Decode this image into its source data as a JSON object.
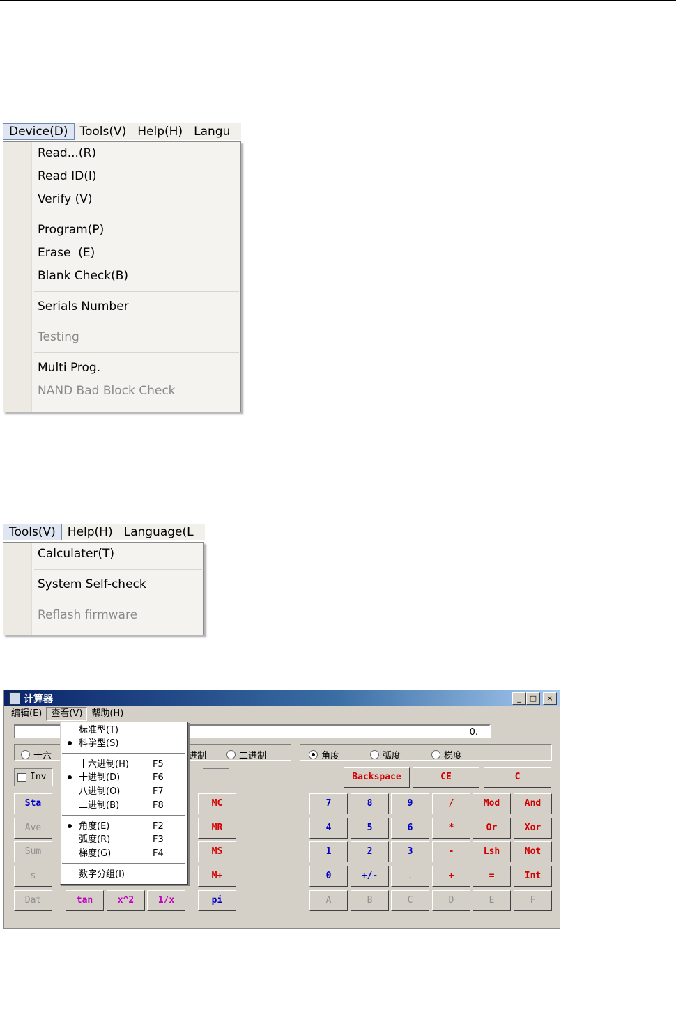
{
  "menubar1": {
    "items": [
      "Device(D)",
      "Tools(V)",
      "Help(H)",
      "Langu"
    ]
  },
  "device_menu": {
    "items": [
      {
        "label": "Read...(R)"
      },
      {
        "label": "Read ID(I)"
      },
      {
        "label": "Verify (V)"
      },
      {
        "label": "Program(P)"
      },
      {
        "label": "Erase  (E)"
      },
      {
        "label": "Blank Check(B)"
      },
      {
        "label": "Serials Number"
      },
      {
        "label": "Testing",
        "disabled": true
      },
      {
        "label": "Multi Prog."
      },
      {
        "label": "NAND Bad Block Check",
        "disabled": true
      }
    ]
  },
  "menubar2": {
    "items": [
      "Tools(V)",
      "Help(H)",
      "Language(L"
    ]
  },
  "tools_menu": {
    "items": [
      {
        "label": "Calculater(T)"
      },
      {
        "label": "System Self-check"
      },
      {
        "label": "Reflash firmware",
        "disabled": true
      }
    ]
  },
  "calculator": {
    "title": "计算器",
    "window_buttons": [
      "_",
      "□",
      "×"
    ],
    "menu": [
      "编辑(E)",
      "查看(V)",
      "帮助(H)"
    ],
    "display": "0.",
    "base_radios": [
      "十六",
      "进制",
      "二进制"
    ],
    "angle_radios": [
      "角度",
      "弧度",
      "梯度"
    ],
    "inv_label": "Inv",
    "view_menu": {
      "items": [
        {
          "label": "标准型(T)",
          "key": ""
        },
        {
          "label": "科学型(S)",
          "key": "",
          "checked": true
        },
        {
          "label": "十六进制(H)",
          "key": "F5"
        },
        {
          "label": "十进制(D)",
          "key": "F6",
          "checked": true
        },
        {
          "label": "八进制(O)",
          "key": "F7"
        },
        {
          "label": "二进制(B)",
          "key": "F8"
        },
        {
          "label": "角度(E)",
          "key": "F2",
          "checked": true
        },
        {
          "label": "弧度(R)",
          "key": "F3"
        },
        {
          "label": "梯度(G)",
          "key": "F4"
        },
        {
          "label": "数字分组(I)",
          "key": ""
        }
      ]
    },
    "keys": {
      "backspace": "Backspace",
      "ce": "CE",
      "c": "C",
      "stat": [
        "Sta",
        "Ave",
        "Sum",
        "s",
        "Dat"
      ],
      "fn": [
        "tan",
        "x^2",
        "1/x"
      ],
      "mem": [
        "MC",
        "MR",
        "MS",
        "M+",
        "pi"
      ],
      "digits": [
        [
          "7",
          "8",
          "9",
          "/",
          "Mod",
          "And"
        ],
        [
          "4",
          "5",
          "6",
          "*",
          "Or",
          "Xor"
        ],
        [
          "1",
          "2",
          "3",
          "-",
          "Lsh",
          "Not"
        ],
        [
          "0",
          "+/-",
          ".",
          "+",
          "=",
          "Int"
        ],
        [
          "A",
          "B",
          "C",
          "D",
          "E",
          "F"
        ]
      ]
    }
  },
  "colors": {
    "accent_red": "#d20000",
    "accent_blue": "#0000c8",
    "accent_magenta": "#c000c0"
  }
}
